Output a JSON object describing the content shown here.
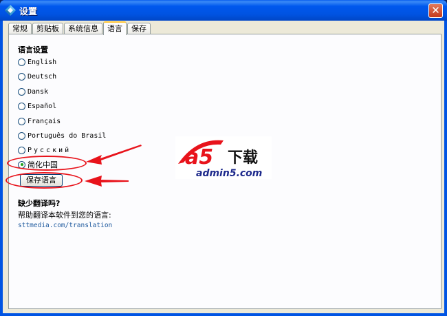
{
  "window": {
    "title": "设置"
  },
  "tabs": [
    {
      "label": "常规",
      "active": false
    },
    {
      "label": "剪贴板",
      "active": false
    },
    {
      "label": "系统信息",
      "active": false
    },
    {
      "label": "语言",
      "active": true
    },
    {
      "label": "保存",
      "active": false
    }
  ],
  "language": {
    "heading": "语言设置",
    "options": [
      {
        "label": "English",
        "checked": false
      },
      {
        "label": "Deutsch",
        "checked": false
      },
      {
        "label": "Dansk",
        "checked": false
      },
      {
        "label": "Español",
        "checked": false
      },
      {
        "label": "Français",
        "checked": false
      },
      {
        "label": "Português do Brasil",
        "checked": false
      },
      {
        "label": "Русский",
        "checked": false
      },
      {
        "label": "简化中国",
        "checked": true
      }
    ],
    "save_label": "保存语言"
  },
  "translation": {
    "title": "缺少翻译吗?",
    "description": "帮助翻译本软件到您的语言:",
    "link": "sttmedia.com/translation"
  },
  "watermark": {
    "logo_text": "a5",
    "download_text": "下载",
    "site": "admin5.com"
  },
  "colors": {
    "titlebar": "#0054E3",
    "dialog_bg": "#ECE9D8",
    "panel_bg": "#FCFCFE",
    "active_tab_accent": "#FFC83C",
    "annotation_red": "#E8131B",
    "link": "#1F5A9E"
  }
}
